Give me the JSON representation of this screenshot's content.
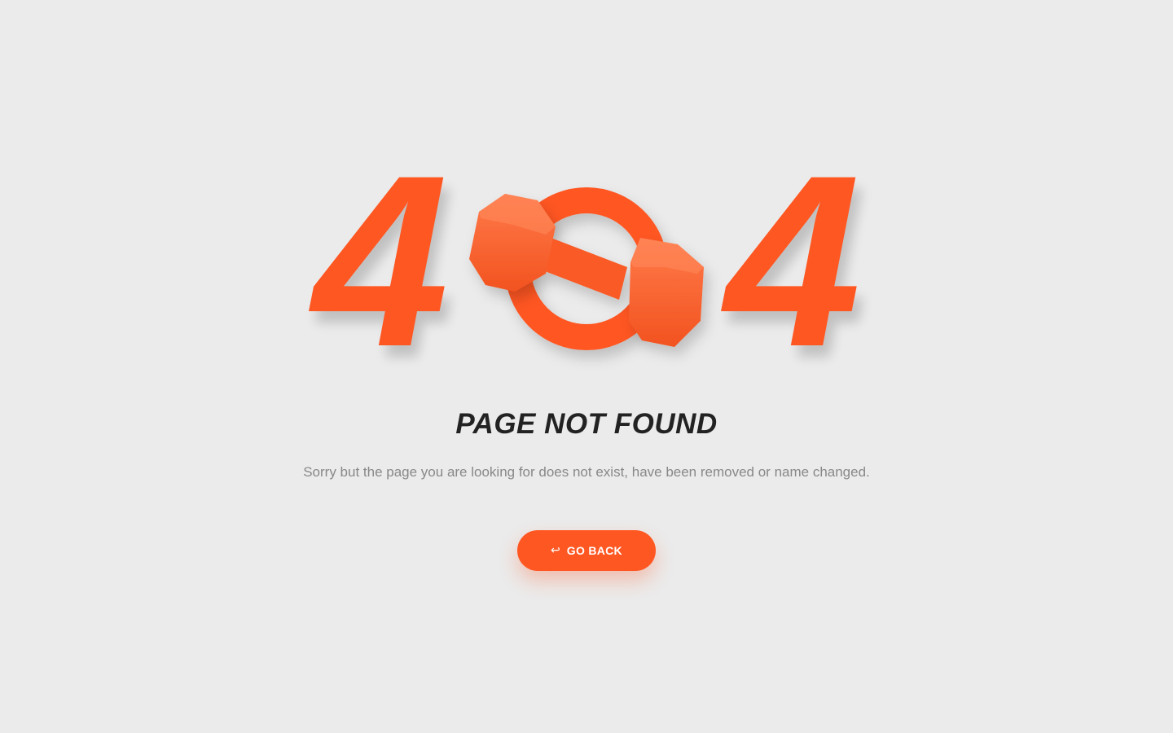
{
  "error": {
    "digit_left": "4",
    "digit_right": "4",
    "zero_graphic": "dumbbell-ring-icon"
  },
  "title": "PAGE NOT FOUND",
  "message": "Sorry but the page you are looking for does not exist, have been removed or name changed.",
  "button": {
    "icon": "return-arrow-icon",
    "icon_glyph": "↩",
    "label": "GO BACK"
  },
  "colors": {
    "accent": "#ff5722",
    "background": "#ebebeb",
    "title": "#222222",
    "message": "#888888"
  }
}
